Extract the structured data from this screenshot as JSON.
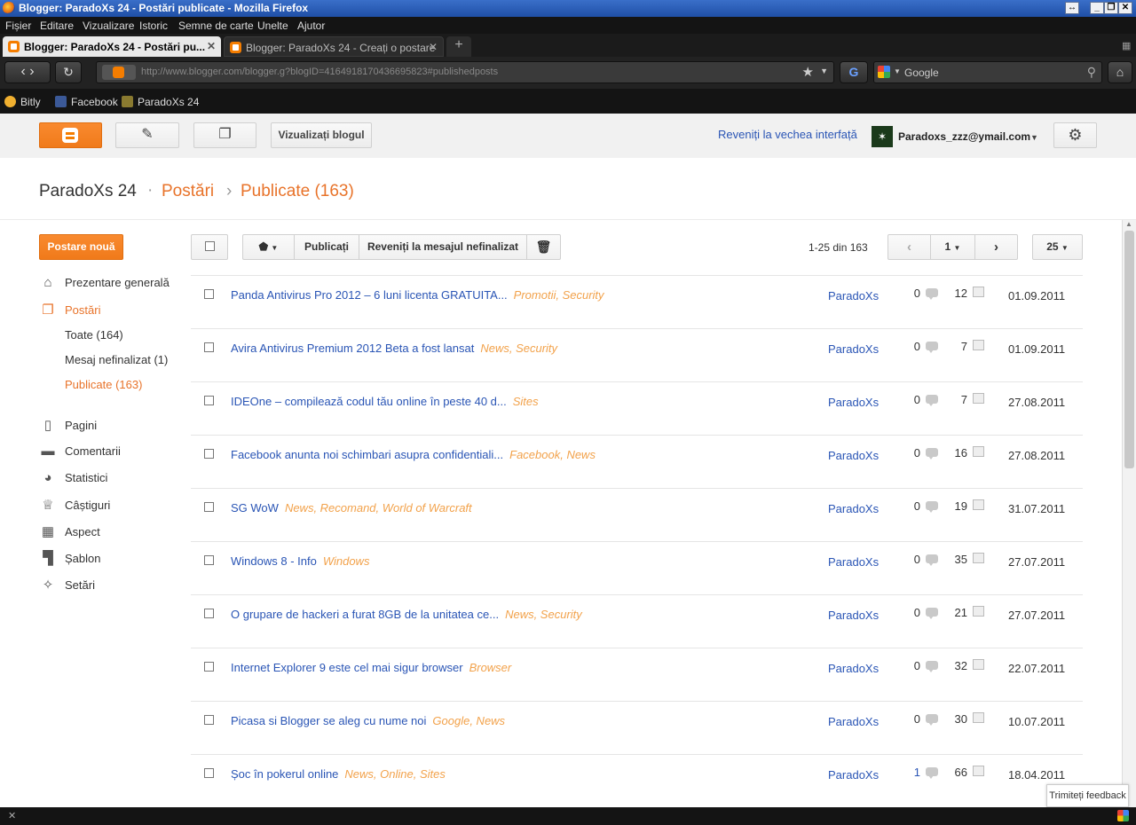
{
  "browser": {
    "window_title": "Blogger: ParadoXs 24 - Postări publicate - Mozilla Firefox",
    "menu": [
      "Fișier",
      "Editare",
      "Vizualizare",
      "Istoric",
      "Semne de carte",
      "Unelte",
      "Ajutor"
    ],
    "tabs": [
      {
        "label": "Blogger: ParadoXs 24 - Postări pu...",
        "active": true
      },
      {
        "label": "Blogger: ParadoXs 24 - Creați o postare",
        "active": false
      }
    ],
    "url": "http://www.blogger.com/blogger.g?blogID=4164918170436695823#publishedposts",
    "search_placeholder": "Google",
    "bookmarks": [
      "Bitly",
      "Facebook",
      "ParadoXs 24"
    ]
  },
  "blogger_toolbar": {
    "view_blog": "Vizualizați blogul",
    "old_interface": "Reveniți la vechea interfață",
    "user_email": "Paradoxs_zzz@ymail.com"
  },
  "header": {
    "blog_title": "ParadoXs 24",
    "crumb_posts": "Postări",
    "crumb_published": "Publicate (163)"
  },
  "sidebar": {
    "new_post": "Postare nouă",
    "overview": "Prezentare generală",
    "posts": "Postări",
    "sub_all": "Toate (164)",
    "sub_drafts": "Mesaj nefinalizat (1)",
    "sub_published": "Publicate (163)",
    "pages": "Pagini",
    "comments": "Comentarii",
    "stats": "Statistici",
    "earnings": "Câștiguri",
    "layout": "Aspect",
    "template": "Șablon",
    "settings": "Setări"
  },
  "content_toolbar": {
    "publish": "Publicați",
    "revert_draft": "Reveniți la mesajul nefinalizat",
    "range": "1-25 din 163",
    "page": "1",
    "per_page": "25"
  },
  "posts": [
    {
      "title": "Panda Antivirus Pro 2012 – 6 luni licenta GRATUITA...",
      "labels": "Promotii, Security",
      "author": "ParadoXs",
      "comments": "0",
      "views": "12",
      "date": "01.09.2011"
    },
    {
      "title": "Avira Antivirus Premium 2012 Beta a fost lansat",
      "labels": "News, Security",
      "author": "ParadoXs",
      "comments": "0",
      "views": "7",
      "date": "01.09.2011"
    },
    {
      "title": "IDEOne – compilează codul tău online în peste 40 d...",
      "labels": "Sites",
      "author": "ParadoXs",
      "comments": "0",
      "views": "7",
      "date": "27.08.2011"
    },
    {
      "title": "Facebook anunta noi schimbari asupra confidentiali...",
      "labels": "Facebook, News",
      "author": "ParadoXs",
      "comments": "0",
      "views": "16",
      "date": "27.08.2011"
    },
    {
      "title": "SG WoW",
      "labels": "News, Recomand, World of Warcraft",
      "author": "ParadoXs",
      "comments": "0",
      "views": "19",
      "date": "31.07.2011"
    },
    {
      "title": "Windows 8 - Info",
      "labels": "Windows",
      "author": "ParadoXs",
      "comments": "0",
      "views": "35",
      "date": "27.07.2011"
    },
    {
      "title": "O grupare de hackeri a furat 8GB de la unitatea ce...",
      "labels": "News, Security",
      "author": "ParadoXs",
      "comments": "0",
      "views": "21",
      "date": "27.07.2011"
    },
    {
      "title": "Internet Explorer 9 este cel mai sigur browser",
      "labels": "Browser",
      "author": "ParadoXs",
      "comments": "0",
      "views": "32",
      "date": "22.07.2011"
    },
    {
      "title": "Picasa si Blogger se aleg cu nume noi",
      "labels": "Google, News",
      "author": "ParadoXs",
      "comments": "0",
      "views": "30",
      "date": "10.07.2011"
    },
    {
      "title": "Șoc în pokerul online",
      "labels": "News, Online, Sites",
      "author": "ParadoXs",
      "comments": "1",
      "views": "66",
      "date": "18.04.2011"
    }
  ],
  "feedback": "Trimiteți feedback",
  "colors": {
    "accent": "#f57d00",
    "link": "#2a55b5",
    "label": "#f2a24b"
  }
}
